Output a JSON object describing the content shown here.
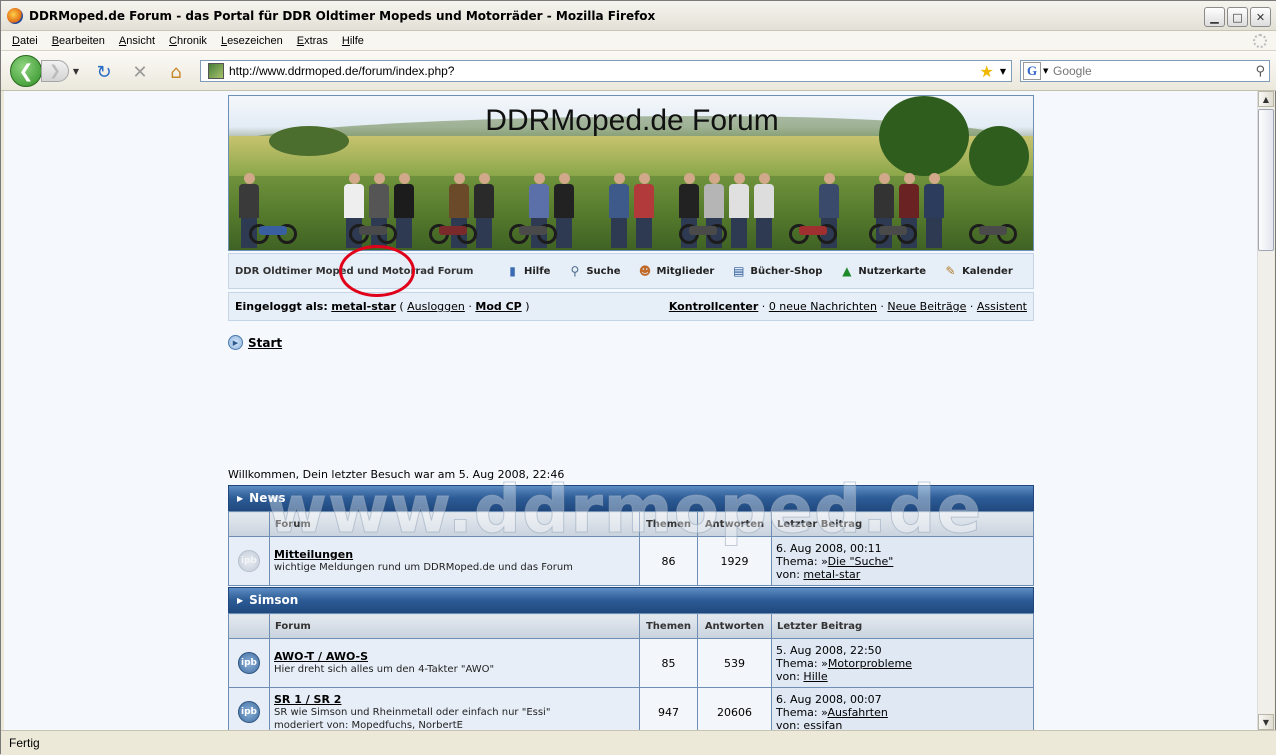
{
  "window": {
    "title": "DDRMoped.de Forum - das Portal für DDR Oldtimer Mopeds und Motorräder - Mozilla Firefox",
    "min_label": "▁",
    "max_label": "□",
    "close_label": "✕"
  },
  "menu": {
    "items": [
      {
        "u": "D",
        "rest": "atei"
      },
      {
        "u": "B",
        "rest": "earbeiten"
      },
      {
        "u": "A",
        "rest": "nsicht"
      },
      {
        "u": "C",
        "rest": "hronik"
      },
      {
        "u": "L",
        "rest": "esezeichen"
      },
      {
        "u": "E",
        "rest": "xtras"
      },
      {
        "u": "H",
        "rest": "ilfe"
      }
    ]
  },
  "nav": {
    "url": "http://www.ddrmoped.de/forum/index.php?",
    "search_placeholder": "Google",
    "search_engine_glyph": "G"
  },
  "status": {
    "text": "Fertig"
  },
  "forum": {
    "banner_title": "DDRMoped.de  Forum",
    "brand": "DDR Oldtimer Moped und Motorrad Forum",
    "links": [
      {
        "label": "Hilfe",
        "icon": "help-book-icon"
      },
      {
        "label": "Suche",
        "icon": "magnifier-icon"
      },
      {
        "label": "Mitglieder",
        "icon": "members-icon"
      },
      {
        "label": "Bücher-Shop",
        "icon": "book-icon"
      },
      {
        "label": "Nutzerkarte",
        "icon": "map-icon"
      },
      {
        "label": "Kalender",
        "icon": "calendar-icon"
      }
    ],
    "logged_in_label": "Eingeloggt als:",
    "username": "metal-star",
    "logout": "Ausloggen",
    "modcp": "Mod CP",
    "control_center": "Kontrollcenter",
    "messages": "0 neue Nachrichten",
    "new_posts": "Neue Beiträge",
    "assistant": "Assistent",
    "crumb": "Start",
    "welcome": "Willkommen, Dein letzter Besuch war am 5. Aug 2008, 22:46",
    "watermark": "www.ddrmoped.de",
    "columns": {
      "forum": "Forum",
      "topics": "Themen",
      "replies": "Antworten",
      "last": "Letzter Beitrag"
    },
    "categories": [
      {
        "name": "News",
        "forums": [
          {
            "name": "Mitteilungen",
            "desc": "wichtige Meldungen rund um DDRMoped.de und das Forum",
            "topics": "86",
            "replies": "1929",
            "date": "6. Aug 2008, 00:11",
            "thema_label": "Thema: »",
            "thema": "Die \"Suche\"",
            "von_label": "von: ",
            "von": "metal-star",
            "state": "off"
          }
        ]
      },
      {
        "name": "Simson",
        "forums": [
          {
            "name": "AWO-T / AWO-S",
            "desc": "Hier dreht sich alles um den 4-Takter \"AWO\"",
            "topics": "85",
            "replies": "539",
            "date": "5. Aug 2008, 22:50",
            "thema_label": "Thema: »",
            "thema": "Motorprobleme",
            "von_label": "von: ",
            "von": "Hille",
            "state": "on"
          },
          {
            "name": "SR 1 / SR 2",
            "desc": "SR wie Simson und Rheinmetall oder einfach nur \"Essi\"",
            "mods": "moderiert von: Mopedfuchs, NorbertE",
            "topics": "947",
            "replies": "20606",
            "date": "6. Aug 2008, 00:07",
            "thema_label": "Thema: »",
            "thema": "Ausfahrten",
            "von_label": "von: ",
            "von": "essifan",
            "state": "on"
          }
        ]
      }
    ]
  }
}
